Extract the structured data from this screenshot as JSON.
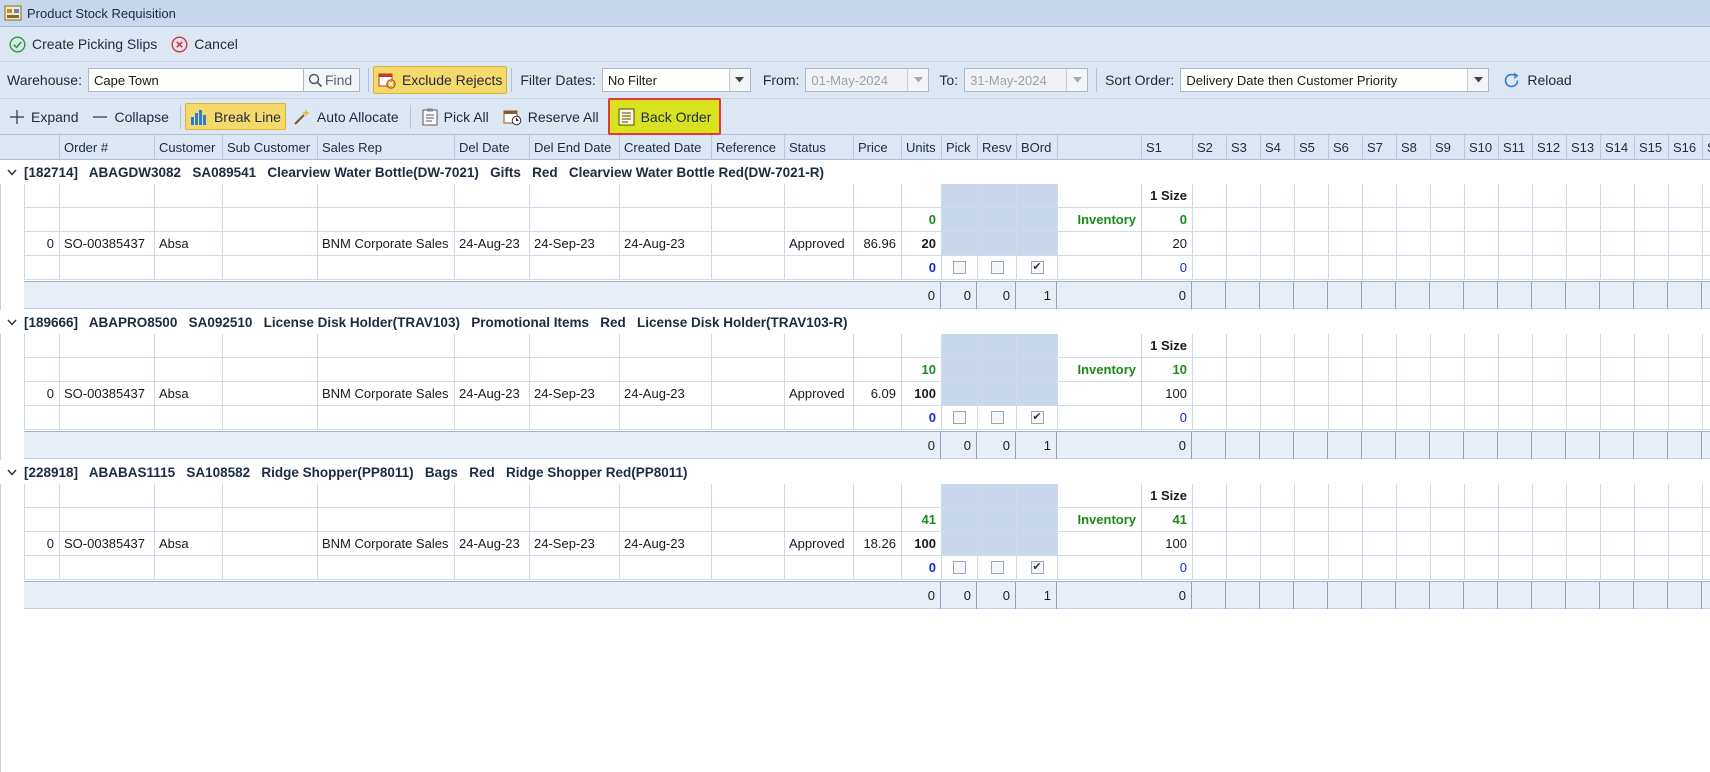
{
  "window": {
    "title": "Product Stock Requisition"
  },
  "toolbar1": {
    "create_label": "Create Picking Slips",
    "cancel_label": "Cancel"
  },
  "toolbar2": {
    "warehouse_label": "Warehouse:",
    "warehouse_value": "Cape Town",
    "find_label": "Find",
    "exclude_rejects_label": "Exclude Rejects",
    "filter_dates_label": "Filter Dates:",
    "filter_value": "No Filter",
    "from_label": "From:",
    "from_value": "01-May-2024",
    "to_label": "To:",
    "to_value": "31-May-2024",
    "sort_label": "Sort Order:",
    "sort_value": "Delivery Date then Customer Priority",
    "reload_label": "Reload"
  },
  "toolbar3": {
    "expand_label": "Expand",
    "collapse_label": "Collapse",
    "break_line_label": "Break Line",
    "auto_allocate_label": "Auto Allocate",
    "pick_all_label": "Pick All",
    "reserve_all_label": "Reserve All",
    "back_order_label": "Back Order"
  },
  "columns": [
    "Order #",
    "Customer",
    "Sub Customer",
    "Sales Rep",
    "Del Date",
    "Del End Date",
    "Created Date",
    "Reference",
    "Status",
    "Price",
    "Units",
    "Pick",
    "Resv",
    "BOrd",
    "S1",
    "S2",
    "S3",
    "S4",
    "S5",
    "S6",
    "S7",
    "S8",
    "S9",
    "S10",
    "S11",
    "S12",
    "S13",
    "S14",
    "S15",
    "S16",
    "S"
  ],
  "groups": [
    {
      "header": "[182714]   ABAGDW3082   SA089541   Clearview Water Bottle(DW-7021)   Gifts   Red   Clearview Water Bottle Red(DW-7021-R)",
      "size_label": "1 Size",
      "inventory_units": "0",
      "inventory_label": "Inventory",
      "inventory_s1": "0",
      "row": {
        "idx": "0",
        "order": "SO-00385437",
        "customer": "Absa",
        "sub_customer": "",
        "sales_rep": "BNM Corporate Sales",
        "del_date": "24-Aug-23",
        "del_end_date": "24-Sep-23",
        "created_date": "24-Aug-23",
        "reference": "",
        "status": "Approved",
        "price": "86.96",
        "units": "20",
        "s1": "20"
      },
      "alloc_units": "0",
      "alloc_s1": "0",
      "pick_checked": false,
      "resv_checked": false,
      "bord_checked": true,
      "totals": {
        "units": "0",
        "pick": "0",
        "resv": "0",
        "bord": "1",
        "s1": "0"
      }
    },
    {
      "header": "[189666]   ABAPRO8500   SA092510   License Disk Holder(TRAV103)   Promotional Items   Red   License Disk Holder(TRAV103-R)",
      "size_label": "1 Size",
      "inventory_units": "10",
      "inventory_label": "Inventory",
      "inventory_s1": "10",
      "row": {
        "idx": "0",
        "order": "SO-00385437",
        "customer": "Absa",
        "sub_customer": "",
        "sales_rep": "BNM Corporate Sales",
        "del_date": "24-Aug-23",
        "del_end_date": "24-Sep-23",
        "created_date": "24-Aug-23",
        "reference": "",
        "status": "Approved",
        "price": "6.09",
        "units": "100",
        "s1": "100"
      },
      "alloc_units": "0",
      "alloc_s1": "0",
      "pick_checked": false,
      "resv_checked": false,
      "bord_checked": true,
      "totals": {
        "units": "0",
        "pick": "0",
        "resv": "0",
        "bord": "1",
        "s1": "0"
      }
    },
    {
      "header": "[228918]   ABABAS1115   SA108582   Ridge Shopper(PP8011)   Bags   Red   Ridge Shopper Red(PP8011)",
      "size_label": "1 Size",
      "inventory_units": "41",
      "inventory_label": "Inventory",
      "inventory_s1": "41",
      "row": {
        "idx": "0",
        "order": "SO-00385437",
        "customer": "Absa",
        "sub_customer": "",
        "sales_rep": "BNM Corporate Sales",
        "del_date": "24-Aug-23",
        "del_end_date": "24-Sep-23",
        "created_date": "24-Aug-23",
        "reference": "",
        "status": "Approved",
        "price": "18.26",
        "units": "100",
        "s1": "100"
      },
      "alloc_units": "0",
      "alloc_s1": "0",
      "pick_checked": false,
      "resv_checked": false,
      "bord_checked": true,
      "totals": {
        "units": "0",
        "pick": "0",
        "resv": "0",
        "bord": "1",
        "s1": "0"
      }
    }
  ],
  "colors": {
    "accent": "#dde7f4",
    "highlight": "#f6d96b",
    "back_order": "#d9e21f",
    "focus_border": "#e23a3a",
    "inventory": "#1d8a1d",
    "allocated": "#1a25d9"
  }
}
